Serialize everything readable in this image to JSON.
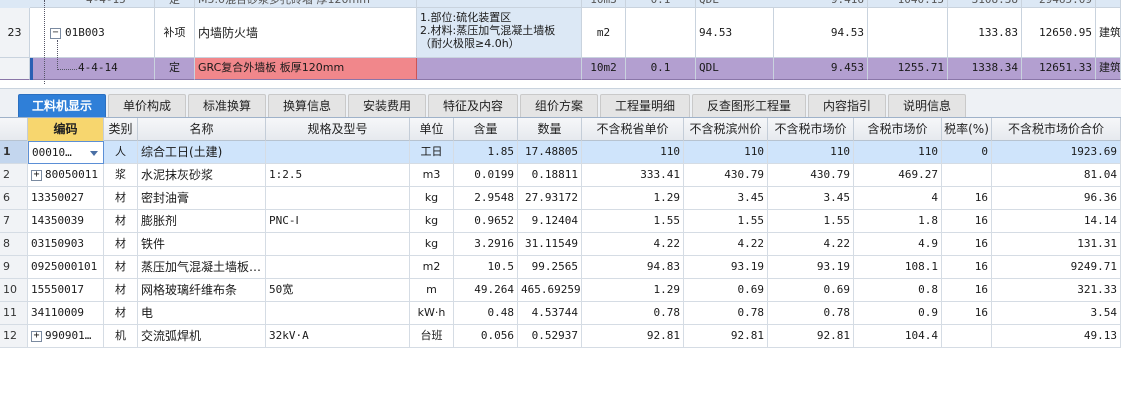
{
  "top_grid": {
    "row_prev": {
      "code": "4-4-15",
      "type": "定",
      "name": "M5.0混合砂浆多孔砖墙 厚120mm",
      "unit": "10m3",
      "qty_expr": "0.1",
      "qty_type": "QDL",
      "qty": "9.416",
      "unit_price": "1040.15",
      "composite_price": "3108.38",
      "total": "29465.09"
    },
    "row_23": {
      "row_no": "23",
      "expander": "−",
      "code": "01B003",
      "type": "补项",
      "name": "内墙防火墙",
      "spec_lines": [
        "1.部位:硫化装置区",
        "2.材料:蒸压加气混凝土墙板",
        "（耐火极限≥4.0h）"
      ],
      "unit": "m2",
      "qty_expr": "94.53",
      "qty": "94.53",
      "composite_price": "133.83",
      "total": "12650.95",
      "category": "建筑"
    },
    "row_sel": {
      "code": "4-4-14",
      "type": "定",
      "name": "GRC复合外墙板 板厚120mm",
      "unit": "10m2",
      "qty_expr": "0.1",
      "qty_type": "QDL",
      "qty": "9.453",
      "unit_price": "1255.71",
      "composite_price": "1338.34",
      "total": "12651.33",
      "category": "建筑"
    }
  },
  "tabs": [
    {
      "label": "工料机显示",
      "active": true
    },
    {
      "label": "单价构成"
    },
    {
      "label": "标准换算"
    },
    {
      "label": "换算信息"
    },
    {
      "label": "安装费用"
    },
    {
      "label": "特征及内容"
    },
    {
      "label": "组价方案"
    },
    {
      "label": "工程量明细"
    },
    {
      "label": "反查图形工程量"
    },
    {
      "label": "内容指引"
    },
    {
      "label": "说明信息"
    }
  ],
  "table": {
    "headers": [
      "",
      "编码",
      "类别",
      "名称",
      "规格及型号",
      "单位",
      "含量",
      "数量",
      "不含税省单价",
      "不含税滨州价",
      "不含税市场价",
      "含税市场价",
      "税率(%)",
      "不含税市场价合价"
    ],
    "rows": [
      {
        "no": "1",
        "code": "00010…",
        "cat": "人",
        "name": "综合工日(土建)",
        "spec": "",
        "unit": "工日",
        "content": "1.85",
        "qty": "17.48805",
        "prov": "110",
        "bz": "110",
        "mkt": "110",
        "mkt_tax": "110",
        "tax": "0",
        "total": "1923.69",
        "expand": false
      },
      {
        "no": "2",
        "code": "80050011",
        "cat": "浆",
        "name": "水泥抹灰砂浆",
        "spec": "1:2.5",
        "unit": "m3",
        "content": "0.0199",
        "qty": "0.18811",
        "prov": "333.41",
        "bz": "430.79",
        "mkt": "430.79",
        "mkt_tax": "469.27",
        "tax": "",
        "total": "81.04",
        "expand": true
      },
      {
        "no": "6",
        "code": "13350027",
        "cat": "材",
        "name": "密封油膏",
        "spec": "",
        "unit": "kg",
        "content": "2.9548",
        "qty": "27.93172",
        "prov": "1.29",
        "bz": "3.45",
        "mkt": "3.45",
        "mkt_tax": "4",
        "tax": "16",
        "total": "96.36",
        "expand": false
      },
      {
        "no": "7",
        "code": "14350039",
        "cat": "材",
        "name": "膨胀剂",
        "spec": "PNC-Ⅰ",
        "unit": "kg",
        "content": "0.9652",
        "qty": "9.12404",
        "prov": "1.55",
        "bz": "1.55",
        "mkt": "1.55",
        "mkt_tax": "1.8",
        "tax": "16",
        "total": "14.14",
        "expand": false
      },
      {
        "no": "8",
        "code": "03150903",
        "cat": "材",
        "name": "铁件",
        "spec": "",
        "unit": "kg",
        "content": "3.2916",
        "qty": "31.11549",
        "prov": "4.22",
        "bz": "4.22",
        "mkt": "4.22",
        "mkt_tax": "4.9",
        "tax": "16",
        "total": "131.31",
        "expand": false
      },
      {
        "no": "9",
        "code": "0925000101",
        "cat": "材",
        "name": "蒸压加气混凝土墙板…",
        "spec": "",
        "unit": "m2",
        "content": "10.5",
        "qty": "99.2565",
        "prov": "94.83",
        "bz": "93.19",
        "mkt": "93.19",
        "mkt_tax": "108.1",
        "tax": "16",
        "total": "9249.71",
        "expand": false
      },
      {
        "no": "10",
        "code": "15550017",
        "cat": "材",
        "name": "网格玻璃纤维布条",
        "spec": "50宽",
        "unit": "m",
        "content": "49.264",
        "qty": "465.69259",
        "prov": "1.29",
        "bz": "0.69",
        "mkt": "0.69",
        "mkt_tax": "0.8",
        "tax": "16",
        "total": "321.33",
        "expand": false
      },
      {
        "no": "11",
        "code": "34110009",
        "cat": "材",
        "name": "电",
        "spec": "",
        "unit": "kW·h",
        "content": "0.48",
        "qty": "4.53744",
        "prov": "0.78",
        "bz": "0.78",
        "mkt": "0.78",
        "mkt_tax": "0.9",
        "tax": "16",
        "total": "3.54",
        "expand": false
      },
      {
        "no": "12",
        "code": "990901…",
        "cat": "机",
        "name": "交流弧焊机",
        "spec": "32kV·A",
        "unit": "台班",
        "content": "0.056",
        "qty": "0.52937",
        "prov": "92.81",
        "bz": "92.81",
        "mkt": "92.81",
        "mkt_tax": "104.4",
        "tax": "",
        "total": "49.13",
        "expand": true
      }
    ]
  },
  "colors": {
    "active_tab": "#2f7fd8",
    "selected_row": "#b39fd0",
    "highlight_name": "#f1878b",
    "sorted_header": "#f7d66e"
  }
}
